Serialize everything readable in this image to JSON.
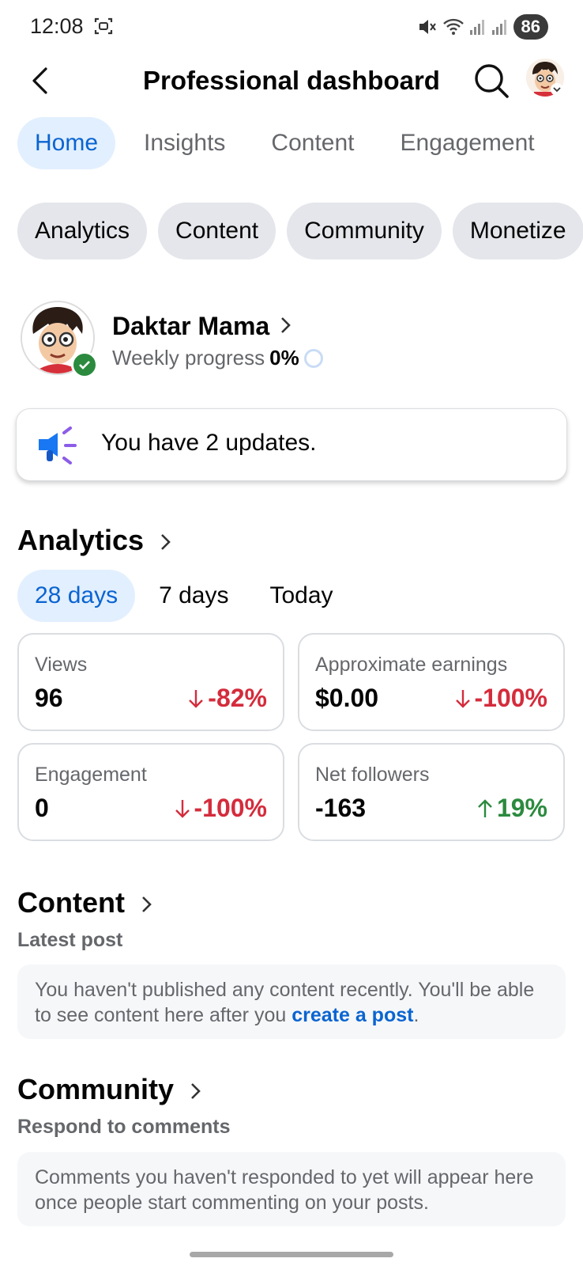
{
  "status_bar": {
    "time": "12:08",
    "battery": "86"
  },
  "header": {
    "title": "Professional dashboard"
  },
  "tabs": [
    {
      "label": "Home",
      "active": true
    },
    {
      "label": "Insights",
      "active": false
    },
    {
      "label": "Content",
      "active": false
    },
    {
      "label": "Engagement",
      "active": false
    }
  ],
  "chips": [
    "Analytics",
    "Content",
    "Community",
    "Monetize"
  ],
  "profile": {
    "name": "Daktar Mama",
    "progress_label": "Weekly progress",
    "progress_value": "0%",
    "progress_fraction": 0
  },
  "updates": {
    "text": "You have 2 updates."
  },
  "analytics": {
    "title": "Analytics",
    "ranges": [
      {
        "label": "28 days",
        "active": true
      },
      {
        "label": "7 days",
        "active": false
      },
      {
        "label": "Today",
        "active": false
      }
    ],
    "metrics": [
      {
        "label": "Views",
        "value": "96",
        "change": "-82%",
        "direction": "down"
      },
      {
        "label": "Approximate earnings",
        "value": "$0.00",
        "change": "-100%",
        "direction": "down"
      },
      {
        "label": "Engagement",
        "value": "0",
        "change": "-100%",
        "direction": "down"
      },
      {
        "label": "Net followers",
        "value": "-163",
        "change": "19%",
        "direction": "up"
      }
    ]
  },
  "content": {
    "title": "Content",
    "subtitle": "Latest post",
    "message": "You haven't published any content recently. You'll be able to see content here after you ",
    "link": "create a post",
    "message_end": "."
  },
  "community": {
    "title": "Community",
    "subtitle": "Respond to comments",
    "message": "Comments you haven't responded to yet will appear here once people start commenting on your posts."
  },
  "colors": {
    "accent": "#0a64d1",
    "negative": "#d42c3c",
    "positive": "#2b8a3e",
    "chip_bg": "#e4e6eb",
    "active_tab_bg": "#e2efff"
  }
}
